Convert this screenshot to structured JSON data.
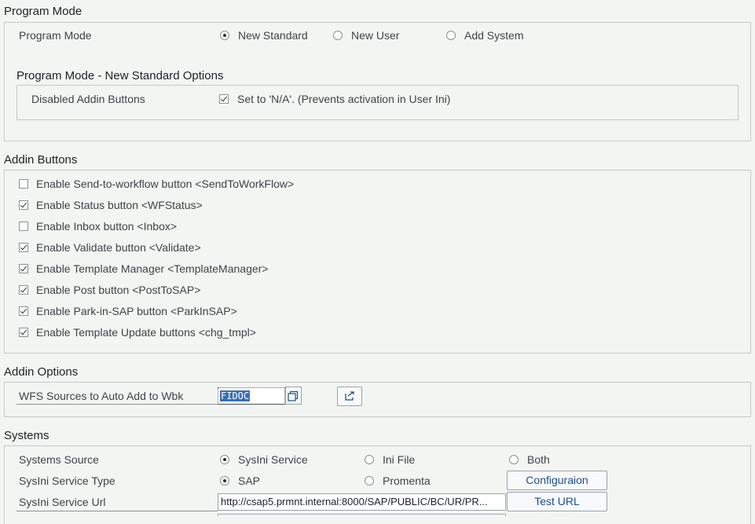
{
  "program_mode": {
    "title": "Program Mode",
    "label": "Program Mode",
    "options": [
      {
        "label": "New Standard",
        "selected": true
      },
      {
        "label": "New User",
        "selected": false
      },
      {
        "label": "Add System",
        "selected": false
      }
    ],
    "sub_title": "Program Mode - New Standard Options",
    "disabled_addin_label": "Disabled Addin Buttons",
    "disabled_addin_checkbox": {
      "label": "Set to 'N/A'. (Prevents activation in User Ini)",
      "checked": true
    }
  },
  "addin_buttons": {
    "title": "Addin Buttons",
    "items": [
      {
        "label": "Enable Send-to-workflow button <SendToWorkFlow>",
        "checked": false
      },
      {
        "label": "Enable Status button <WFStatus>",
        "checked": true
      },
      {
        "label": "Enable Inbox button <Inbox>",
        "checked": false
      },
      {
        "label": "Enable Validate button <Validate>",
        "checked": true
      },
      {
        "label": "Enable Template Manager <TemplateManager>",
        "checked": true
      },
      {
        "label": "Enable Post button <PostToSAP>",
        "checked": true
      },
      {
        "label": "Enable Park-in-SAP button <ParkInSAP>",
        "checked": true
      },
      {
        "label": "Enable Template Update buttons <chg_tmpl>",
        "checked": true
      }
    ]
  },
  "addin_options": {
    "title": "Addin Options",
    "wfs_label": "WFS Sources to Auto Add to Wbk",
    "wfs_value": "FIDOC"
  },
  "systems": {
    "title": "Systems",
    "source_label": "Systems Source",
    "source_options": [
      {
        "label": "SysIni Service",
        "selected": true
      },
      {
        "label": "Ini File",
        "selected": false
      },
      {
        "label": "Both",
        "selected": false
      }
    ],
    "service_type_label": "SysIni Service Type",
    "service_type_options": [
      {
        "label": "SAP",
        "selected": true
      },
      {
        "label": "Promenta",
        "selected": false
      }
    ],
    "config_button": "Configuraion",
    "url_label": "SysIni Service Url",
    "url_value": "http://csap5.prmnt.internal:8000/SAP/PUBLIC/BC/UR/PR...",
    "test_url_button": "Test URL"
  }
}
